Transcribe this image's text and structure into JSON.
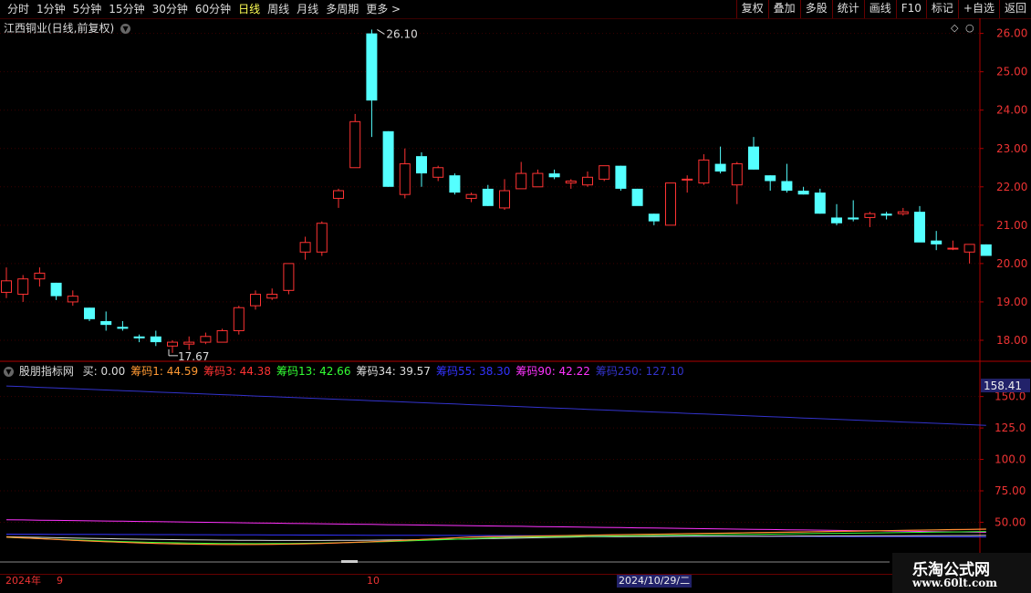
{
  "toolbar": {
    "periods": [
      "分时",
      "1分钟",
      "5分钟",
      "15分钟",
      "30分钟",
      "60分钟",
      "日线",
      "周线",
      "月线",
      "多周期",
      "更多 >"
    ],
    "active": "日线",
    "right": [
      "复权",
      "叠加",
      "多股",
      "统计",
      "画线",
      "F10",
      "标记",
      "+自选",
      "返回"
    ]
  },
  "chart": {
    "title": "江西铜业(日线,前复权)",
    "price_ticks": [
      "26.00",
      "25.00",
      "24.00",
      "23.00",
      "22.00",
      "21.00",
      "20.00",
      "19.00",
      "18.00"
    ],
    "high_label": "26.10",
    "low_label": "17.67"
  },
  "indicator": {
    "name": "股朋指标网",
    "items": [
      {
        "label": "买: 0.00",
        "color": "#dddddd"
      },
      {
        "label": "筹码1: 44.59",
        "color": "#ff9933"
      },
      {
        "label": "筹码3: 44.38",
        "color": "#ff3333"
      },
      {
        "label": "筹码13: 42.66",
        "color": "#33ff33"
      },
      {
        "label": "筹码34: 39.57",
        "color": "#dddddd"
      },
      {
        "label": "筹码55: 38.30",
        "color": "#3333ff"
      },
      {
        "label": "筹码90: 42.22",
        "color": "#ff33ff"
      },
      {
        "label": "筹码250: 127.10",
        "color": "#3333cc"
      }
    ],
    "ticks": [
      "150.0",
      "125.0",
      "100.0",
      "75.00",
      "50.00"
    ],
    "badge": "158.41"
  },
  "dates": {
    "year": "2024年",
    "m9": "9",
    "m10": "10",
    "cursor": "2024/10/29/二"
  },
  "logo": {
    "line1": "乐淘公式网",
    "line2": "www.60lt.com"
  },
  "colors": {
    "up": "#ff3333",
    "down": "#54ffff",
    "axis": "#b00000",
    "grid": "#3a0000"
  },
  "chart_data": {
    "type": "candlestick",
    "ohlc": [
      [
        19.25,
        19.9,
        19.1,
        19.55
      ],
      [
        19.2,
        19.7,
        19.0,
        19.6
      ],
      [
        19.6,
        19.9,
        19.4,
        19.75
      ],
      [
        19.5,
        19.5,
        19.05,
        19.15
      ],
      [
        19.0,
        19.3,
        18.9,
        19.15
      ],
      [
        18.85,
        18.85,
        18.5,
        18.55
      ],
      [
        18.5,
        18.75,
        18.25,
        18.4
      ],
      [
        18.35,
        18.5,
        18.25,
        18.3
      ],
      [
        18.1,
        18.15,
        17.95,
        18.05
      ],
      [
        18.1,
        18.25,
        17.85,
        17.95
      ],
      [
        17.85,
        18.0,
        17.67,
        17.95
      ],
      [
        17.9,
        18.1,
        17.75,
        17.95
      ],
      [
        17.95,
        18.2,
        17.9,
        18.1
      ],
      [
        17.95,
        18.3,
        17.95,
        18.25
      ],
      [
        18.25,
        18.9,
        18.15,
        18.85
      ],
      [
        18.9,
        19.3,
        18.8,
        19.2
      ],
      [
        19.1,
        19.35,
        19.05,
        19.2
      ],
      [
        19.3,
        20.0,
        19.2,
        20.0
      ],
      [
        20.3,
        20.7,
        20.1,
        20.55
      ],
      [
        20.3,
        21.1,
        20.2,
        21.05
      ],
      [
        21.7,
        21.95,
        21.45,
        21.9
      ],
      [
        22.5,
        23.9,
        22.55,
        23.7
      ],
      [
        26.0,
        26.1,
        23.3,
        24.25
      ],
      [
        23.45,
        23.45,
        22.0,
        22.0
      ],
      [
        21.8,
        23.0,
        21.7,
        22.6
      ],
      [
        22.8,
        22.9,
        22.0,
        22.35
      ],
      [
        22.25,
        22.55,
        22.15,
        22.5
      ],
      [
        22.3,
        22.35,
        21.8,
        21.85
      ],
      [
        21.7,
        21.85,
        21.6,
        21.8
      ],
      [
        21.95,
        22.05,
        21.5,
        21.5
      ],
      [
        21.45,
        22.2,
        21.4,
        21.9
      ],
      [
        21.95,
        22.65,
        21.95,
        22.35
      ],
      [
        22.0,
        22.45,
        22.0,
        22.35
      ],
      [
        22.35,
        22.45,
        22.2,
        22.25
      ],
      [
        22.1,
        22.2,
        21.95,
        22.15
      ],
      [
        22.05,
        22.4,
        22.0,
        22.25
      ],
      [
        22.2,
        22.3,
        22.15,
        22.55
      ],
      [
        22.55,
        22.55,
        21.9,
        21.95
      ],
      [
        21.95,
        21.95,
        21.55,
        21.5
      ],
      [
        21.3,
        21.3,
        21.0,
        21.1
      ],
      [
        21.0,
        21.9,
        21.0,
        22.1
      ],
      [
        22.2,
        22.3,
        21.85,
        22.2
      ],
      [
        22.1,
        22.85,
        22.05,
        22.7
      ],
      [
        22.6,
        23.05,
        22.35,
        22.4
      ],
      [
        22.05,
        22.65,
        21.55,
        22.6
      ],
      [
        23.05,
        23.3,
        22.45,
        22.45
      ],
      [
        22.3,
        22.3,
        21.9,
        22.15
      ],
      [
        22.15,
        22.6,
        21.85,
        21.9
      ],
      [
        21.9,
        22.0,
        21.8,
        21.8
      ],
      [
        21.85,
        21.95,
        21.3,
        21.3
      ],
      [
        21.2,
        21.55,
        21.0,
        21.05
      ],
      [
        21.2,
        21.65,
        21.1,
        21.15
      ],
      [
        21.2,
        21.35,
        20.95,
        21.3
      ],
      [
        21.3,
        21.35,
        21.15,
        21.25
      ],
      [
        21.3,
        21.45,
        21.25,
        21.35
      ],
      [
        21.35,
        21.5,
        20.6,
        20.55
      ],
      [
        20.6,
        20.85,
        20.35,
        20.5
      ],
      [
        20.4,
        20.6,
        20.35,
        20.4
      ],
      [
        20.3,
        20.5,
        20.0,
        20.5
      ],
      [
        20.5,
        20.5,
        20.2,
        20.2
      ]
    ],
    "ylim": [
      17.5,
      26.3
    ],
    "indicator_ylim": [
      30,
      165
    ]
  }
}
